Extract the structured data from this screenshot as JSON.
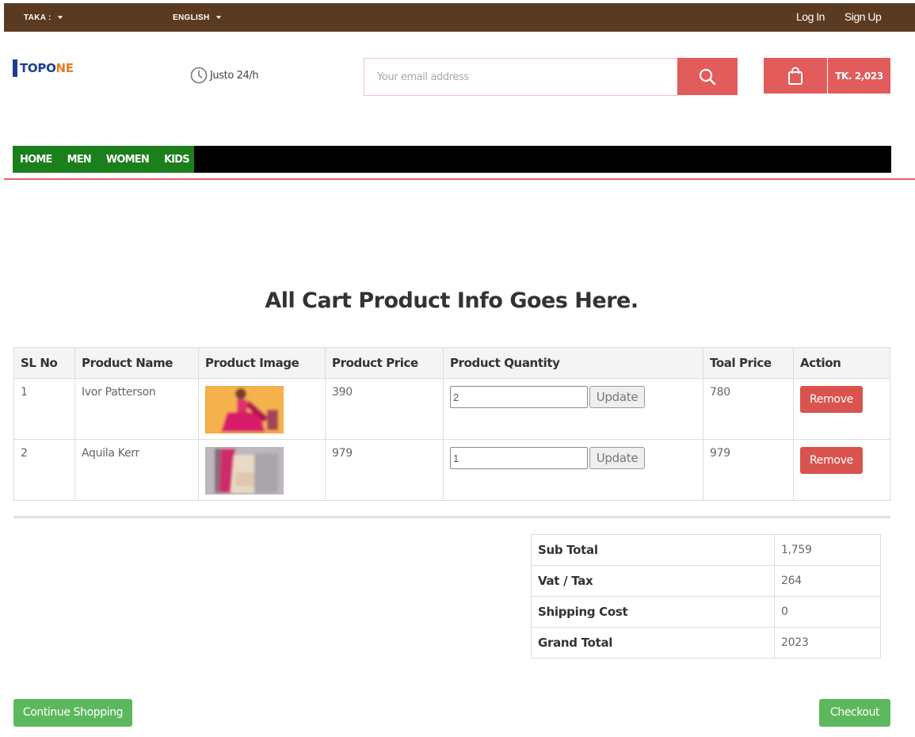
{
  "topbar": {
    "currency_label": "TAKA :",
    "language_label": "ENGLISH",
    "login": "Log In",
    "signup": "Sign Up"
  },
  "header": {
    "logo_part1": "TOPO",
    "logo_part2": "NE",
    "hours": "Justo 24/h",
    "search_placeholder": "Your email address",
    "cart_total": "TK. 2,023"
  },
  "nav": {
    "items": [
      "HOME",
      "MEN",
      "WOMEN",
      "KIDS"
    ]
  },
  "page": {
    "heading": "All Cart Product Info Goes Here."
  },
  "cart": {
    "headers": [
      "SL No",
      "Product Name",
      "Product Image",
      "Product Price",
      "Product Quantity",
      "Toal Price",
      "Action"
    ],
    "rows": [
      {
        "sl": "1",
        "name": "Ivor Patterson",
        "price": "390",
        "qty": "2",
        "total": "780",
        "update": "Update",
        "remove": "Remove"
      },
      {
        "sl": "2",
        "name": "Aquila Kerr",
        "price": "979",
        "qty": "1",
        "total": "979",
        "update": "Update",
        "remove": "Remove"
      }
    ]
  },
  "totals": {
    "rows": [
      {
        "label": "Sub Total",
        "value": "1,759"
      },
      {
        "label": "Vat / Tax",
        "value": "264"
      },
      {
        "label": "Shipping Cost",
        "value": "0"
      },
      {
        "label": "Grand Total",
        "value": "2023"
      }
    ]
  },
  "actions": {
    "continue": "Continue Shopping",
    "checkout": "Checkout"
  },
  "colors": {
    "topbar": "#5a3b22",
    "accent_red": "#e25c5c",
    "nav_green": "#1b7f1b",
    "button_green": "#5cb85c"
  }
}
